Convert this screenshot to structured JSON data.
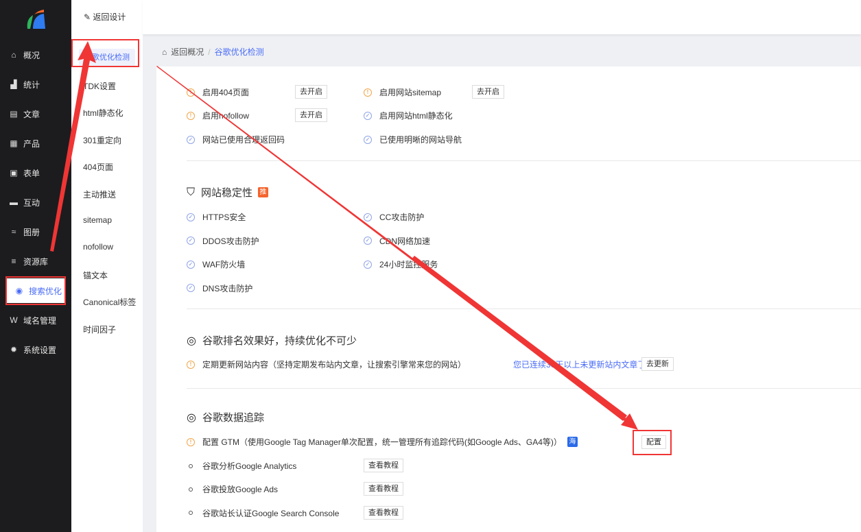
{
  "sidebar": {
    "items": [
      {
        "label": "概况",
        "icon": "home-icon"
      },
      {
        "label": "统计",
        "icon": "chart-icon"
      },
      {
        "label": "文章",
        "icon": "article-icon"
      },
      {
        "label": "产品",
        "icon": "grid-icon"
      },
      {
        "label": "表单",
        "icon": "form-icon"
      },
      {
        "label": "互动",
        "icon": "chat-icon"
      },
      {
        "label": "图册",
        "icon": "gallery-icon"
      },
      {
        "label": "资源库",
        "icon": "database-icon"
      },
      {
        "label": "搜索优化",
        "icon": "seo-icon",
        "active": true
      },
      {
        "label": "域名管理",
        "icon": "domain-icon"
      },
      {
        "label": "系统设置",
        "icon": "gear-icon"
      }
    ]
  },
  "subnav": {
    "back": "返回设计",
    "active": "谷歌优化检测",
    "items": [
      "TDK设置",
      "html静态化",
      "301重定向",
      "404页面",
      "主动推送",
      "sitemap",
      "nofollow",
      "锚文本",
      "Canonical标签",
      "时间因子"
    ]
  },
  "breadcrumb": {
    "back": "返回概况",
    "sep": "/",
    "current": "谷歌优化检测"
  },
  "checks_top": [
    {
      "label": "启用404页面",
      "status": "warn",
      "button": "去开启"
    },
    {
      "label": "启用网站sitemap",
      "status": "warn",
      "button": "去开启"
    },
    {
      "label": "启用nofollow",
      "status": "warn",
      "button": "去开启"
    },
    {
      "label": "启用网站html静态化",
      "status": "ok"
    },
    {
      "label": "网站已使用合理返回码",
      "status": "ok"
    },
    {
      "label": "已使用明晰的网站导航",
      "status": "ok"
    }
  ],
  "stability": {
    "title": "网站稳定性",
    "tag": "推",
    "tag_color": "#f5642d",
    "items": [
      "HTTPS安全",
      "CC攻击防护",
      "DDOS攻击防护",
      "CDN网络加速",
      "WAF防火墙",
      "24小时监控服务",
      "DNS攻击防护"
    ]
  },
  "ranking": {
    "title": "谷歌排名效果好，持续优化不可少",
    "item": "定期更新网站内容（坚持定期发布站内文章，让搜索引擎常来您的网站）",
    "notice": "您已连续30天以上未更新站内文章了",
    "button": "去更新"
  },
  "tracking": {
    "title": "谷歌数据追踪",
    "gtm": "配置 GTM（使用Google Tag Manager单次配置，统一管理所有追踪代码(如Google Ads、GA4等)）",
    "gtm_tag": "海",
    "gtm_tag_color": "#2a6ae8",
    "gtm_button": "配置",
    "items": [
      {
        "label": "谷歌分析Google Analytics",
        "button": "查看教程"
      },
      {
        "label": "谷歌投放Google Ads",
        "button": "查看教程"
      },
      {
        "label": "谷歌站长认证Google Search Console",
        "button": "查看教程"
      }
    ]
  },
  "colors": {
    "accent": "#4a6cf7",
    "annotation": "#f03535",
    "sidebar": "#1c1c1e"
  }
}
